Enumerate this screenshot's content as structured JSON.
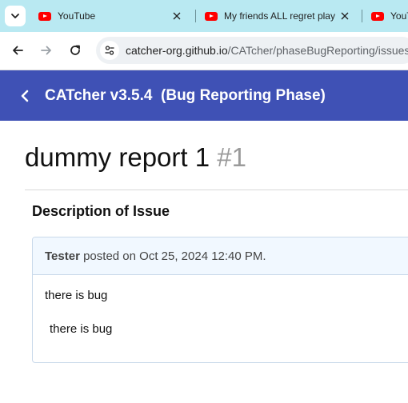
{
  "browser": {
    "tabs": [
      {
        "title": "YouTube",
        "icon": "youtube-icon"
      },
      {
        "title": "My friends ALL regret play",
        "icon": "youtube-icon"
      },
      {
        "title": "YouT",
        "icon": "youtube-icon"
      }
    ],
    "url_host": "catcher-org.github.io",
    "url_path": "/CATcher/phaseBugReporting/issues"
  },
  "app": {
    "title": "CATcher v3.5.4  (Bug Reporting Phase)",
    "accent_color": "#3f51b5"
  },
  "issue": {
    "title": "dummy report 1",
    "number": "#1",
    "section_heading": "Description of Issue",
    "comment": {
      "author": "Tester",
      "meta": " posted on Oct 25, 2024 12:40 PM.",
      "body_line_1": "there is bug",
      "body_line_2": "there is bug"
    }
  }
}
